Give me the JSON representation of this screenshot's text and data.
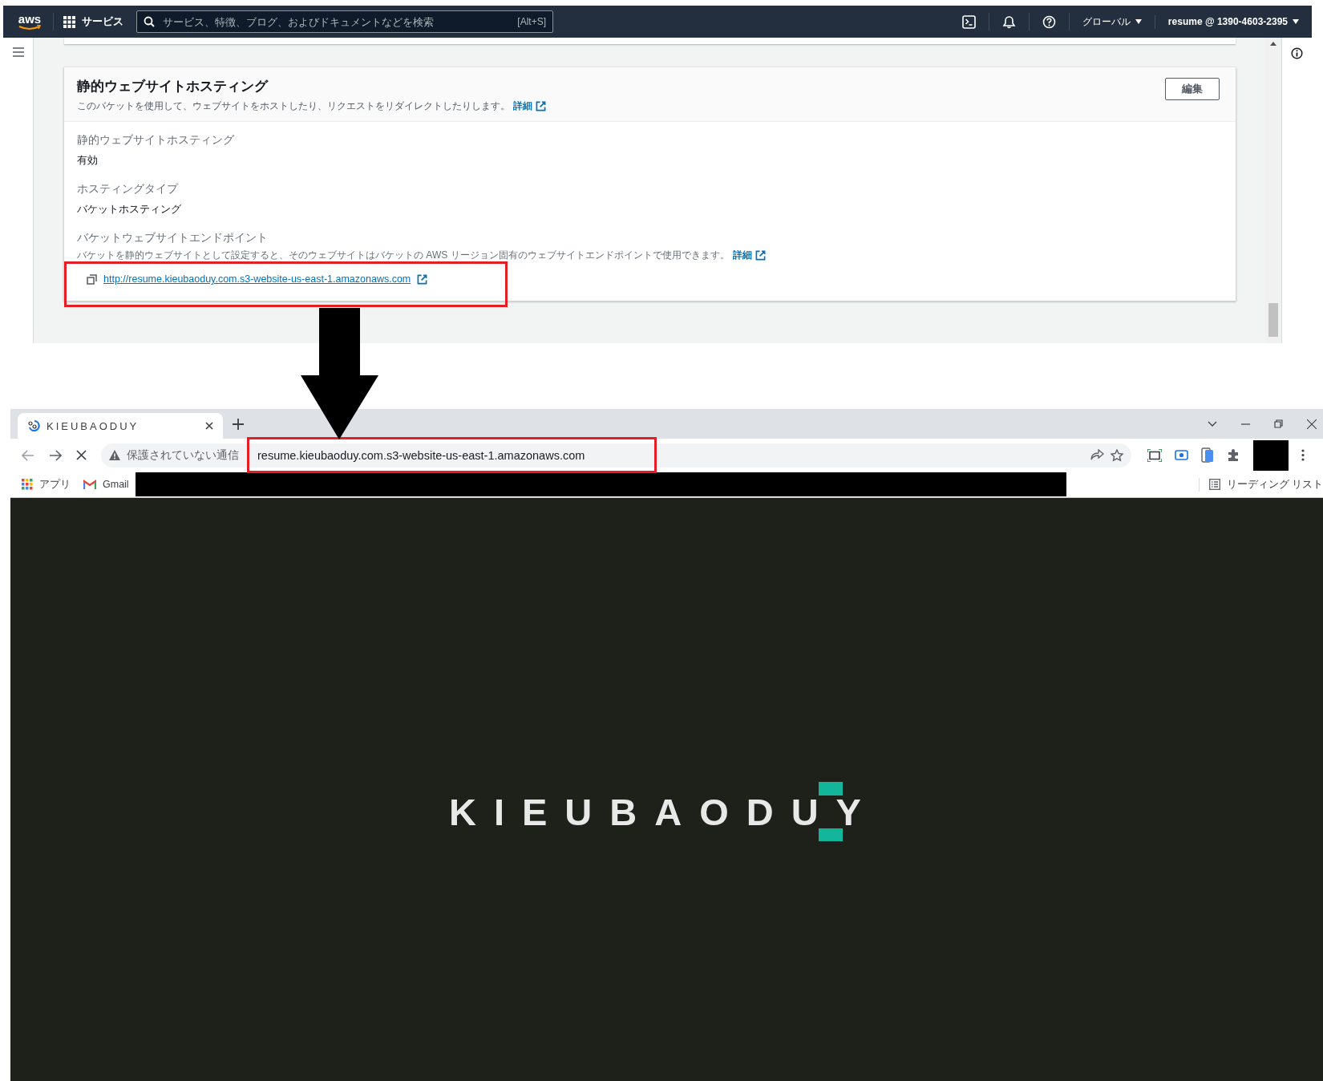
{
  "aws_console": {
    "nav": {
      "logo": "aws",
      "services_label": "サービス",
      "search_placeholder": "サービス、特徴、ブログ、およびドキュメントなどを検索",
      "search_shortcut": "[Alt+S]",
      "region": "グローバル",
      "account": "resume @ 1390-4603-2395"
    },
    "panel": {
      "title": "静的ウェブサイトホスティング",
      "description": "このバケットを使用して、ウェブサイトをホストしたり、リクエストをリダイレクトしたりします。",
      "description_link": "詳細",
      "edit_button": "編集",
      "fields": [
        {
          "label": "静的ウェブサイトホスティング",
          "value": "有効"
        },
        {
          "label": "ホスティングタイプ",
          "value": "バケットホスティング"
        }
      ],
      "endpoint": {
        "label": "バケットウェブサイトエンドポイント",
        "description": "バケットを静的ウェブサイトとして設定すると、そのウェブサイトはバケットの AWS リージョン固有のウェブサイトエンドポイントで使用できます。",
        "description_link": "詳細",
        "url": "http://resume.kieubaoduy.com.s3-website-us-east-1.amazonaws.com"
      }
    }
  },
  "browser": {
    "tab": {
      "title": "KIEUBAODUY"
    },
    "address_bar": {
      "security_label": "保護されていない通信",
      "url": "resume.kieubaoduy.com.s3-website-us-east-1.amazonaws.com"
    },
    "bookmarks": [
      {
        "label": "アプリ",
        "kind": "apps"
      },
      {
        "label": "Gmail",
        "kind": "gmail"
      }
    ],
    "reading_list": "リーディング リスト",
    "page": {
      "logo_text": "KIEUBAODUY"
    }
  }
}
